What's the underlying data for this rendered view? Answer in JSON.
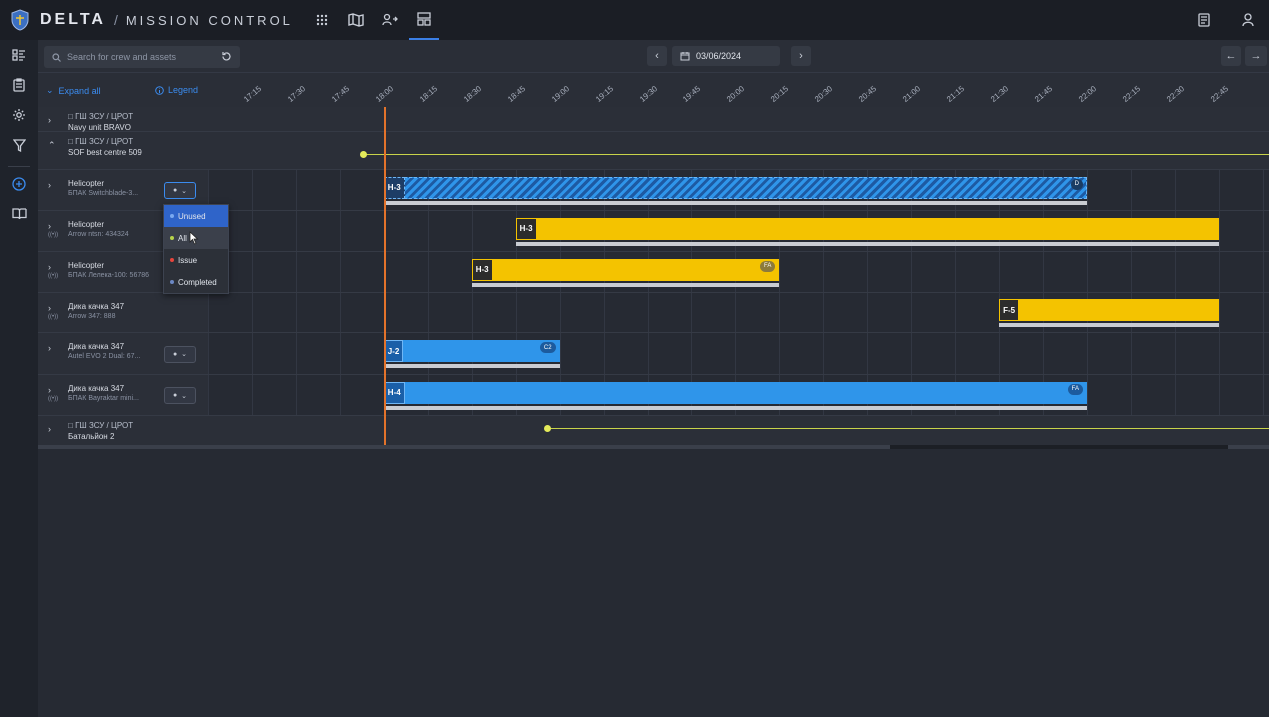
{
  "topbar": {
    "brand": "DELTA",
    "separator": "/",
    "app_name": "MISSION CONTROL"
  },
  "toolbar": {
    "search_placeholder": "Search for crew and assets",
    "date": "03/06/2024"
  },
  "timeline_header": {
    "expand_all": "Expand all",
    "legend": "Legend",
    "ticks": [
      "17:15",
      "17:30",
      "17:45",
      "18:00",
      "18:15",
      "18:30",
      "18:45",
      "19:00",
      "19:15",
      "19:30",
      "19:45",
      "20:00",
      "20:15",
      "20:30",
      "20:45",
      "21:00",
      "21:15",
      "21:30",
      "21:45",
      "22:00",
      "22:15",
      "22:30",
      "22:45"
    ]
  },
  "rows": [
    {
      "type": "group",
      "path": "ГШ ЗСУ / ЦРОТ",
      "name": "Navy unit BRAVO",
      "expanded": false
    },
    {
      "type": "group",
      "path": "ГШ ЗСУ / ЦРОТ",
      "name": "SOF best centre 509",
      "expanded": true
    },
    {
      "type": "asset",
      "name": "Helicopter",
      "sub": "БПАК Switchblade-3...",
      "has_status": true,
      "radio": false
    },
    {
      "type": "asset",
      "name": "Helicopter",
      "sub": "Arrow ntsn: 434324",
      "has_status": false,
      "radio": true
    },
    {
      "type": "asset",
      "name": "Helicopter",
      "sub": "БПАК Лелека-100: 56786",
      "has_status": false,
      "radio": true
    },
    {
      "type": "asset",
      "name": "Дика качка 347",
      "sub": "Arrow 347: 888",
      "has_status": false,
      "radio": true
    },
    {
      "type": "asset",
      "name": "Дика качка 347",
      "sub": "Autel EVO 2 Dual: 67...",
      "has_status": true,
      "radio": false
    },
    {
      "type": "asset",
      "name": "Дика качка 347",
      "sub": "БПАК Bayraktar mini...",
      "has_status": true,
      "radio": true
    },
    {
      "type": "group",
      "path": "ГШ ЗСУ / ЦРОТ",
      "name": "Батальйон 2",
      "expanded": false
    }
  ],
  "bars": [
    {
      "row": 2,
      "label": "H-3",
      "badge": "D",
      "style": "hatch",
      "start": "18:00",
      "end": "22:00"
    },
    {
      "row": 3,
      "label": "H-3",
      "badge": "",
      "style": "yellow",
      "start": "18:45",
      "end": "22:45"
    },
    {
      "row": 4,
      "label": "H-3",
      "badge": "FA",
      "style": "yellow",
      "start": "18:30",
      "end": "20:15"
    },
    {
      "row": 5,
      "label": "F-5",
      "badge": "",
      "style": "yellow",
      "start": "21:30",
      "end": "22:45"
    },
    {
      "row": 6,
      "label": "J-2",
      "badge": "C2",
      "style": "blue",
      "start": "18:00",
      "end": "19:00"
    },
    {
      "row": 7,
      "label": "H-4",
      "badge": "FA",
      "style": "blue",
      "start": "18:00",
      "end": "22:00"
    }
  ],
  "status_dropdown": {
    "options": [
      {
        "label": "Unused",
        "color": "#7aa9f0",
        "selected": true
      },
      {
        "label": "All",
        "color": "#b7d34a",
        "hovered": true
      },
      {
        "label": "Issue",
        "color": "#e8453c"
      },
      {
        "label": "Completed",
        "color": "#6c88c4"
      }
    ]
  },
  "colors": {
    "accent": "#3b8cf0",
    "now_line": "#e3732b",
    "yellow_bar": "#f4c300",
    "blue_bar": "#2f95ea"
  }
}
